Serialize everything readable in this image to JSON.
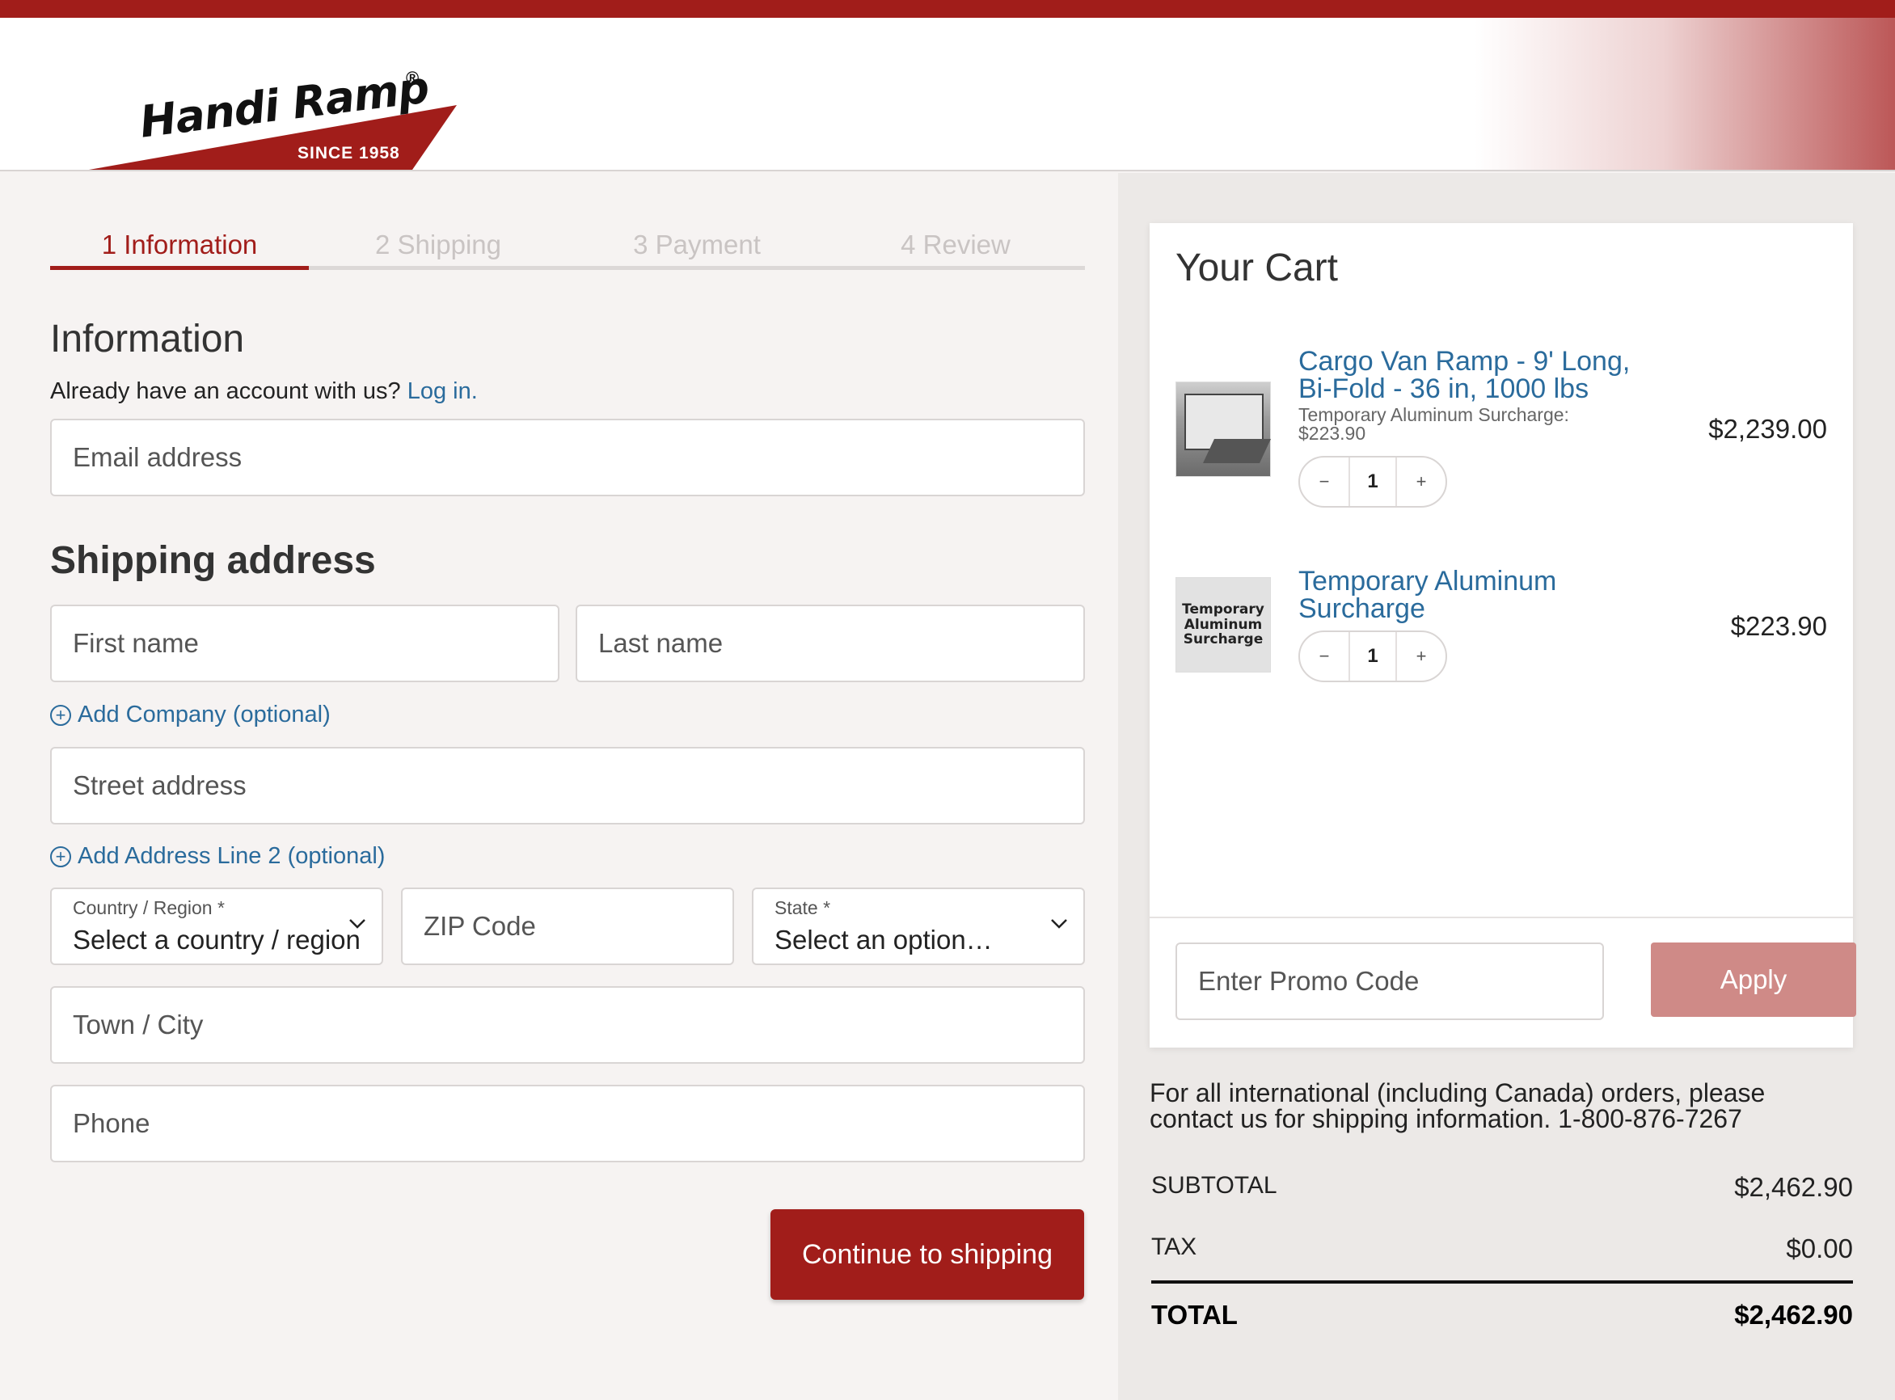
{
  "brand": {
    "name": "Handi Ramp",
    "reg": "®",
    "since": "SINCE 1958",
    "accent": "#a11d1a",
    "link_color": "#2a6b9c"
  },
  "steps": [
    {
      "label": "1 Information",
      "active": true
    },
    {
      "label": "2 Shipping",
      "active": false
    },
    {
      "label": "3 Payment",
      "active": false
    },
    {
      "label": "4 Review",
      "active": false
    }
  ],
  "information": {
    "heading": "Information",
    "account_prompt": "Already have an account with us?",
    "login_link": "Log in.",
    "email_placeholder": "Email address"
  },
  "shipping": {
    "heading": "Shipping address",
    "first_name_placeholder": "First name",
    "last_name_placeholder": "Last name",
    "add_company": "Add Company (optional)",
    "street_placeholder": "Street address",
    "add_line2": "Add Address Line 2 (optional)",
    "country_label": "Country / Region *",
    "country_value": "Select a country / region",
    "zip_placeholder": "ZIP Code",
    "state_label": "State *",
    "state_value": "Select an option…",
    "city_placeholder": "Town / City",
    "phone_placeholder": "Phone",
    "continue_button": "Continue to shipping"
  },
  "cart": {
    "title": "Your Cart",
    "items": [
      {
        "name_line1": "Cargo Van Ramp - 9' Long,",
        "name_line2": "Bi-Fold - 36 in, 1000 lbs",
        "sub_line1": "Temporary Aluminum Surcharge:",
        "sub_line2": "$223.90",
        "price": "$2,239.00",
        "qty": "1",
        "image_icon": "cargo-van-ramp-photo"
      },
      {
        "name_line1": "Temporary Aluminum",
        "name_line2": "Surcharge",
        "price": "$223.90",
        "qty": "1",
        "image_text": "Temporary Aluminum Surcharge"
      }
    ],
    "qty_minus": "−",
    "qty_plus": "+",
    "promo_placeholder": "Enter Promo Code",
    "apply_button": "Apply"
  },
  "summary": {
    "intl_note_line1": "For all international (including Canada) orders, please",
    "intl_note_line2": "contact us for shipping information. 1-800-876-7267",
    "subtotal_label": "SUBTOTAL",
    "subtotal_value": "$2,462.90",
    "tax_label": "TAX",
    "tax_value": "$0.00",
    "total_label": "TOTAL",
    "total_value": "$2,462.90"
  }
}
